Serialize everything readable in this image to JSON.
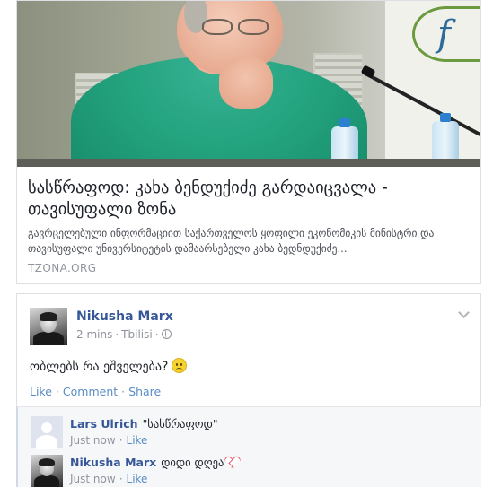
{
  "link_card": {
    "title": "სასწრაფოდ: კახა ბენდუქიძე გარდაიცვალა - თავისუფალი ზონა",
    "description": "გავრცელებული ინფორმაციით საქართველოს ყოფილი ეკონომიკის მინისტრი და თავისუფალი უნივერსიტეტის დამაარსებელი კახა ბედნდუქიძე...",
    "domain": "TZONA.ORG"
  },
  "post": {
    "author": "Nikusha Marx",
    "time": "2 mins",
    "location": "Tbilisi",
    "text": "ობლებს რა ეშველება?",
    "actions": {
      "like": "Like",
      "comment": "Comment",
      "share": "Share"
    }
  },
  "comments": [
    {
      "author": "Lars Ulrich",
      "text": "\"სასწრაფოდ\"",
      "time": "Just now",
      "like": "Like"
    },
    {
      "author": "Nikusha Marx",
      "text": "დიდი დღეა",
      "time": "Just now",
      "like": "Like"
    }
  ],
  "icons": {
    "privacy": "globe-icon",
    "post_menu": "chevron-down-icon",
    "emoji": "frown-emoji-icon",
    "comment_emoji": "heart-icon"
  },
  "colors": {
    "link_blue": "#365899",
    "action_blue": "#598dc5",
    "meta_gray": "#90949c",
    "heart_red": "#e04a5f"
  }
}
